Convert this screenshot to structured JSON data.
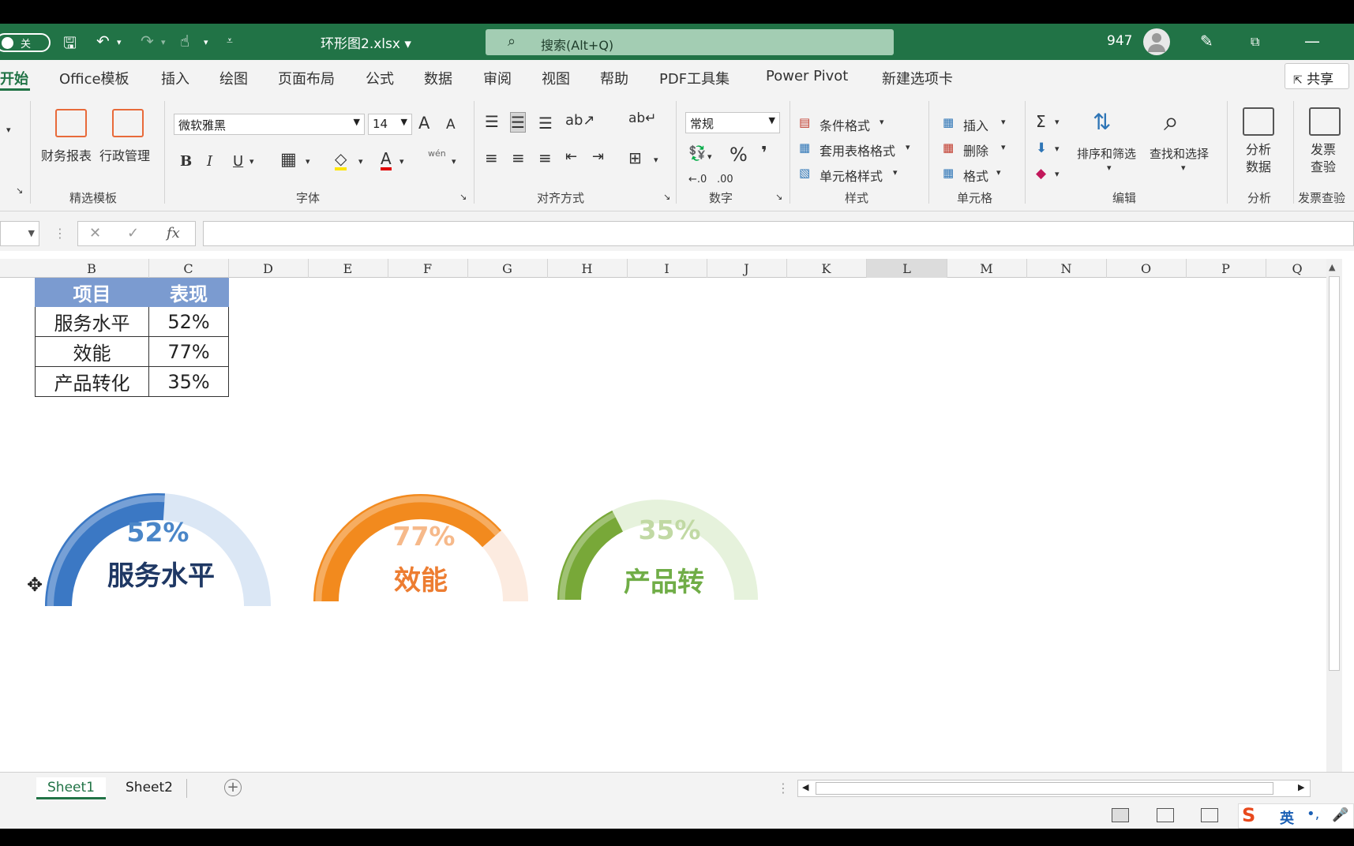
{
  "titlebar": {
    "autosave_label": "关",
    "filename": "环形图2.xlsx ▾",
    "search_icon": "search-icon",
    "search_placeholder": "搜索(Alt+Q)",
    "count": "947"
  },
  "tabs": [
    "开始",
    "Office模板",
    "插入",
    "绘图",
    "页面布局",
    "公式",
    "数据",
    "审阅",
    "视图",
    "帮助",
    "PDF工具集",
    "Power Pivot",
    "新建选项卡"
  ],
  "share_label": "共享",
  "ribbon": {
    "templates": {
      "btn1": "财务报表",
      "btn2": "行政管理",
      "label": "精选模板"
    },
    "font": {
      "name": "微软雅黑",
      "size": "14",
      "label": "字体",
      "bold": "B",
      "italic": "I",
      "underline": "U",
      "grow": "A",
      "shrink": "A",
      "color": "A",
      "wen": "wén"
    },
    "alignment": {
      "label": "对齐方式"
    },
    "number": {
      "format": "常规",
      "percent": "%",
      "comma": "❜",
      "label": "数字"
    },
    "styles": {
      "cond": "条件格式",
      "table": "套用表格格式",
      "cell": "单元格样式",
      "label": "样式"
    },
    "cells": {
      "insert": "插入",
      "delete": "删除",
      "format": "格式",
      "label": "单元格"
    },
    "editing": {
      "sort": "排序和筛选",
      "find": "查找和选择",
      "label": "编辑",
      "sigma": "Σ"
    },
    "analysis": {
      "btn": "分析\n数据",
      "btn1": "分析",
      "btn2": "数据",
      "label": "分析"
    },
    "invoice": {
      "btn1": "发票",
      "btn2": "查验",
      "label": "发票查验"
    }
  },
  "formula": {
    "fx": "fx",
    "cancel": "✕",
    "enter": "✓"
  },
  "columns": [
    "B",
    "C",
    "D",
    "E",
    "F",
    "G",
    "H",
    "I",
    "J",
    "K",
    "L",
    "M",
    "N",
    "O",
    "P",
    "Q"
  ],
  "table": {
    "headers": [
      "项目",
      "表现"
    ],
    "rows": [
      [
        "服务水平",
        "52%"
      ],
      [
        "效能",
        "77%"
      ],
      [
        "产品转化",
        "35%"
      ]
    ]
  },
  "charts": [
    {
      "value": 0.52,
      "label": "52%",
      "name": "服务水平",
      "color": "#3b78c4",
      "track": "#dbe7f5",
      "label_color": "#4a86c8",
      "name_color": "#1f3864"
    },
    {
      "value": 0.77,
      "label": "77%",
      "name": "效能",
      "color": "#f28a1e",
      "track": "#fcebe0",
      "label_color": "#f6b98a",
      "name_color": "#ed7d31"
    },
    {
      "value": 0.35,
      "label": "35%",
      "name": "产品转",
      "color": "#78a838",
      "track": "#e6f2dc",
      "label_color": "#c1d9a4",
      "name_color": "#70ad47"
    }
  ],
  "sheets": [
    "Sheet1",
    "Sheet2"
  ],
  "statusbar": {
    "ime": "英"
  }
}
